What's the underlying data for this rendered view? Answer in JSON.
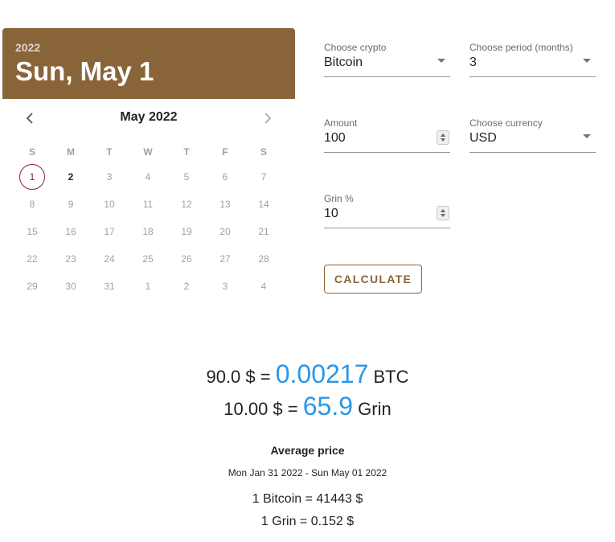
{
  "calendar": {
    "year": "2022",
    "selected_date": "Sun, May 1",
    "month_label": "May 2022",
    "weekdays": [
      "S",
      "M",
      "T",
      "W",
      "T",
      "F",
      "S"
    ],
    "weeks": [
      [
        "1",
        "2",
        "3",
        "4",
        "5",
        "6",
        "7"
      ],
      [
        "8",
        "9",
        "10",
        "11",
        "12",
        "13",
        "14"
      ],
      [
        "15",
        "16",
        "17",
        "18",
        "19",
        "20",
        "21"
      ],
      [
        "22",
        "23",
        "24",
        "25",
        "26",
        "27",
        "28"
      ],
      [
        "29",
        "30",
        "31",
        "1",
        "2",
        "3",
        "4"
      ]
    ],
    "selected_day": "1",
    "enabled_days": [
      "1",
      "2"
    ],
    "colors": {
      "header": "#8a6439",
      "selected_ring": "#8f1c3a"
    }
  },
  "form": {
    "crypto": {
      "label": "Choose crypto",
      "value": "Bitcoin"
    },
    "period": {
      "label": "Choose period (months)",
      "value": "3"
    },
    "amount": {
      "label": "Amount",
      "value": "100"
    },
    "currency": {
      "label": "Choose currency",
      "value": "USD"
    },
    "grin_pct": {
      "label": "Grin %",
      "value": "10"
    },
    "calculate_label": "CALCULATE"
  },
  "result": {
    "line1": {
      "prefix": "90.0 $ = ",
      "amount": "0.00217",
      "suffix": " BTC"
    },
    "line2": {
      "prefix": "10.00 $ = ",
      "amount": "65.9",
      "suffix": " Grin"
    },
    "avg_title": "Average price",
    "avg_range": "Mon Jan 31 2022 - Sun May 01 2022",
    "avg_price1": "1 Bitcoin = 41443 $",
    "avg_price2": "1 Grin = 0.152 $",
    "accent_color": "#2b97e6"
  }
}
